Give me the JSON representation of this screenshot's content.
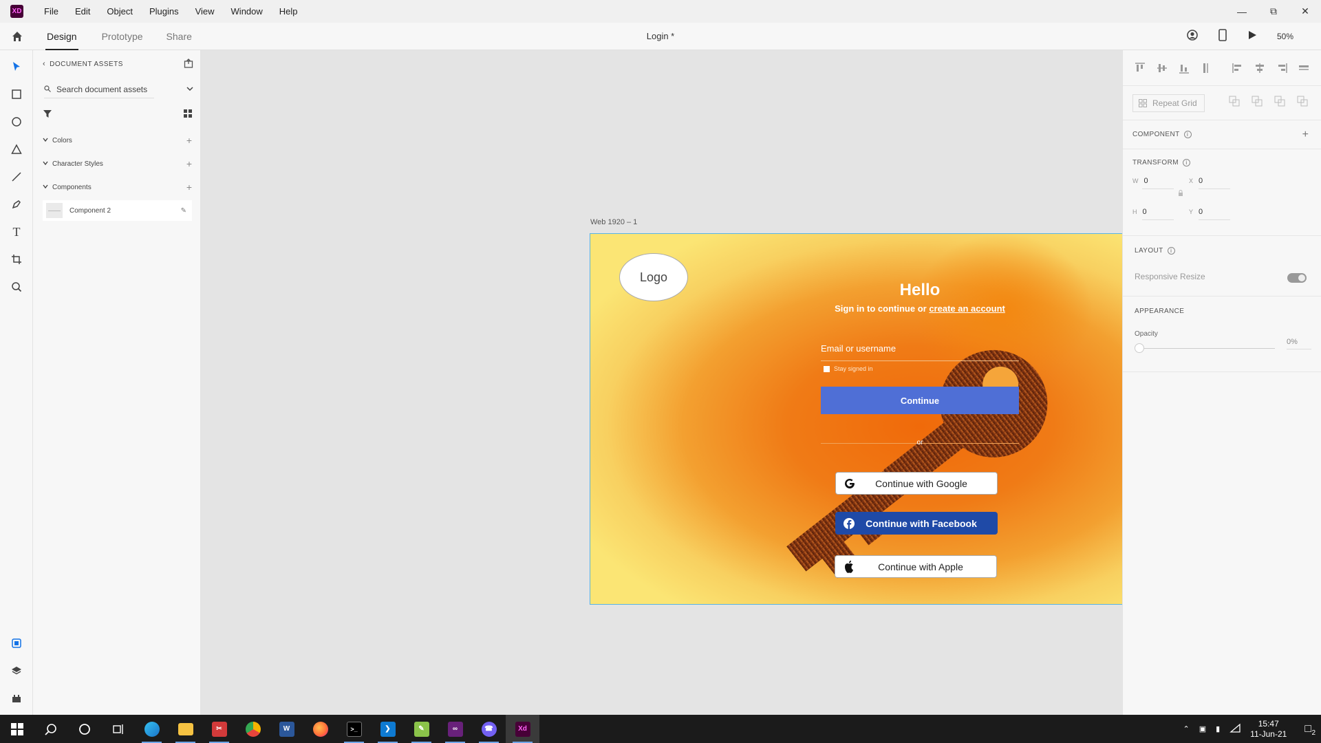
{
  "window": {
    "app_icon": "XD",
    "menu": [
      "File",
      "Edit",
      "Object",
      "Plugins",
      "View",
      "Window",
      "Help"
    ]
  },
  "toolbar": {
    "tabs": [
      "Design",
      "Prototype",
      "Share"
    ],
    "doc_title": "Login *",
    "zoom": "50%"
  },
  "assets": {
    "header": "DOCUMENT ASSETS",
    "search_placeholder": "Search document assets",
    "sections": [
      "Colors",
      "Character Styles",
      "Components"
    ],
    "component_name": "Component 2"
  },
  "artboard": {
    "label": "Web 1920 – 1",
    "logo": "Logo",
    "hello": "Hello",
    "signin_prefix": "Sign in to continue or ",
    "signin_link": "create an account",
    "email_placeholder": "Email or username",
    "stay_signed_in": "Stay signed in",
    "continue": "Continue",
    "or": "or",
    "google": "Continue with Google",
    "facebook": "Continue with Facebook",
    "apple": "Continue with Apple"
  },
  "right_panel": {
    "repeat_grid": "Repeat Grid",
    "component": "COMPONENT",
    "transform": "TRANSFORM",
    "w_label": "W",
    "w_value": "0",
    "h_label": "H",
    "h_value": "0",
    "x_label": "X",
    "x_value": "0",
    "y_label": "Y",
    "y_value": "0",
    "layout": "LAYOUT",
    "responsive_resize": "Responsive Resize",
    "appearance": "APPEARANCE",
    "opacity_label": "Opacity",
    "opacity_value": "0%"
  },
  "taskbar": {
    "time": "15:47",
    "date": "11-Jun-21",
    "notifications": "2"
  }
}
